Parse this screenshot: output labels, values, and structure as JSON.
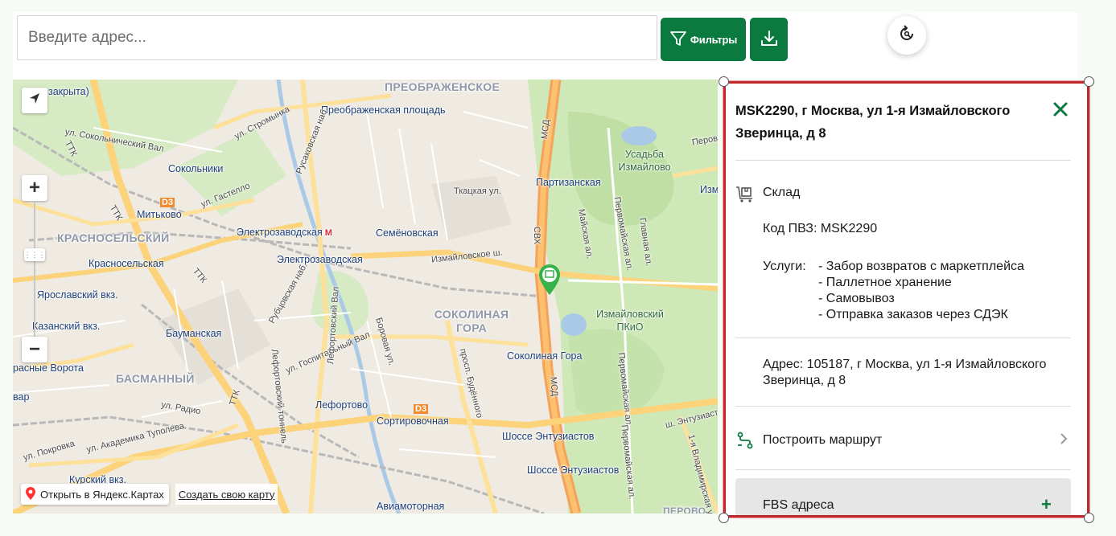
{
  "search": {
    "placeholder": "Введите адрес..."
  },
  "toolbar": {
    "filters_label": "Фильтры",
    "filter_icon": "funnel-icon",
    "download_icon": "download-icon",
    "refresh_icon": "refresh-location-icon"
  },
  "colors": {
    "accent": "#0a7a3f",
    "selection_border": "#c0282b",
    "metro": "#d9303b"
  },
  "map": {
    "districts": [
      "ПРЕОБРАЖЕНСКОЕ",
      "КРАСНОСЕЛЬСКИЙ",
      "СОКОЛИНАЯ ГОРА",
      "БАСМАННЫЙ",
      "ПЕРОВО"
    ],
    "stations": [
      "Преображенская площадь",
      "Сокольники",
      "Митьково",
      "Электрозаводская",
      "Семёновская",
      "Партизанская",
      "Красносельская",
      "Ярославский вкз.",
      "Казанский вкз.",
      "Бауманская",
      "Соколиная Гора",
      "Лефортово",
      "Сортировочная",
      "Шоссе Энтузиастов",
      "Авиамоторная",
      "Курский вкз.",
      "расные Ворота"
    ],
    "streets": [
      "ул. Стромынка",
      "ул. Сокольнический Вал",
      "Русаковская наб.",
      "ул. Гастелло",
      "Ткацкая ул.",
      "Измайловское ш.",
      "Рубцовская наб.",
      "ул. Госпитальный Вал",
      "Лефортовский Вал",
      "Боровая ул.",
      "Лефортовский тоннель",
      "просп. Будённого",
      "ул. Радио",
      "ул. Академика Туполева",
      "ул. Покровка",
      "ш. Энтузиастов",
      "Майская ал.",
      "Первомайская ал.",
      "Главная ал.",
      "Первомайская ал.",
      "Первомайская ал.",
      "1-я Владимирская ул.",
      "ТТК",
      "ТТК",
      "ТТК",
      "ТТК",
      "СВХ",
      "МСД",
      "МСД",
      "D3",
      "D3",
      "закрыта)",
      "Измайловский ПКиО",
      "Усадьба Измайлово",
      "Изм",
      "Перов",
      "вар"
    ],
    "open_in_yandex": "Открыть в Яндекс.Картах",
    "create_map": "Создать свою карту",
    "zoom_in": "+",
    "zoom_out": "−"
  },
  "panel": {
    "title": "MSK2290, г Москва, ул 1-я Измайловского Зверинца, д 8",
    "type_label": "Склад",
    "code_label": "Код ПВЗ: MSK2290",
    "services_label": "Услуги:",
    "services": [
      "- Забор возвратов с маркетплейса",
      "- Паллетное хранение",
      "- Самовывоз",
      "- Отправка заказов через СДЭК"
    ],
    "address_label": "Адрес: 105187, г Москва, ул 1-я Измайловского Зверинца, д 8",
    "route_label": "Построить маршрут",
    "fbs_label": "FBS адреса",
    "fbs_plus": "+"
  }
}
